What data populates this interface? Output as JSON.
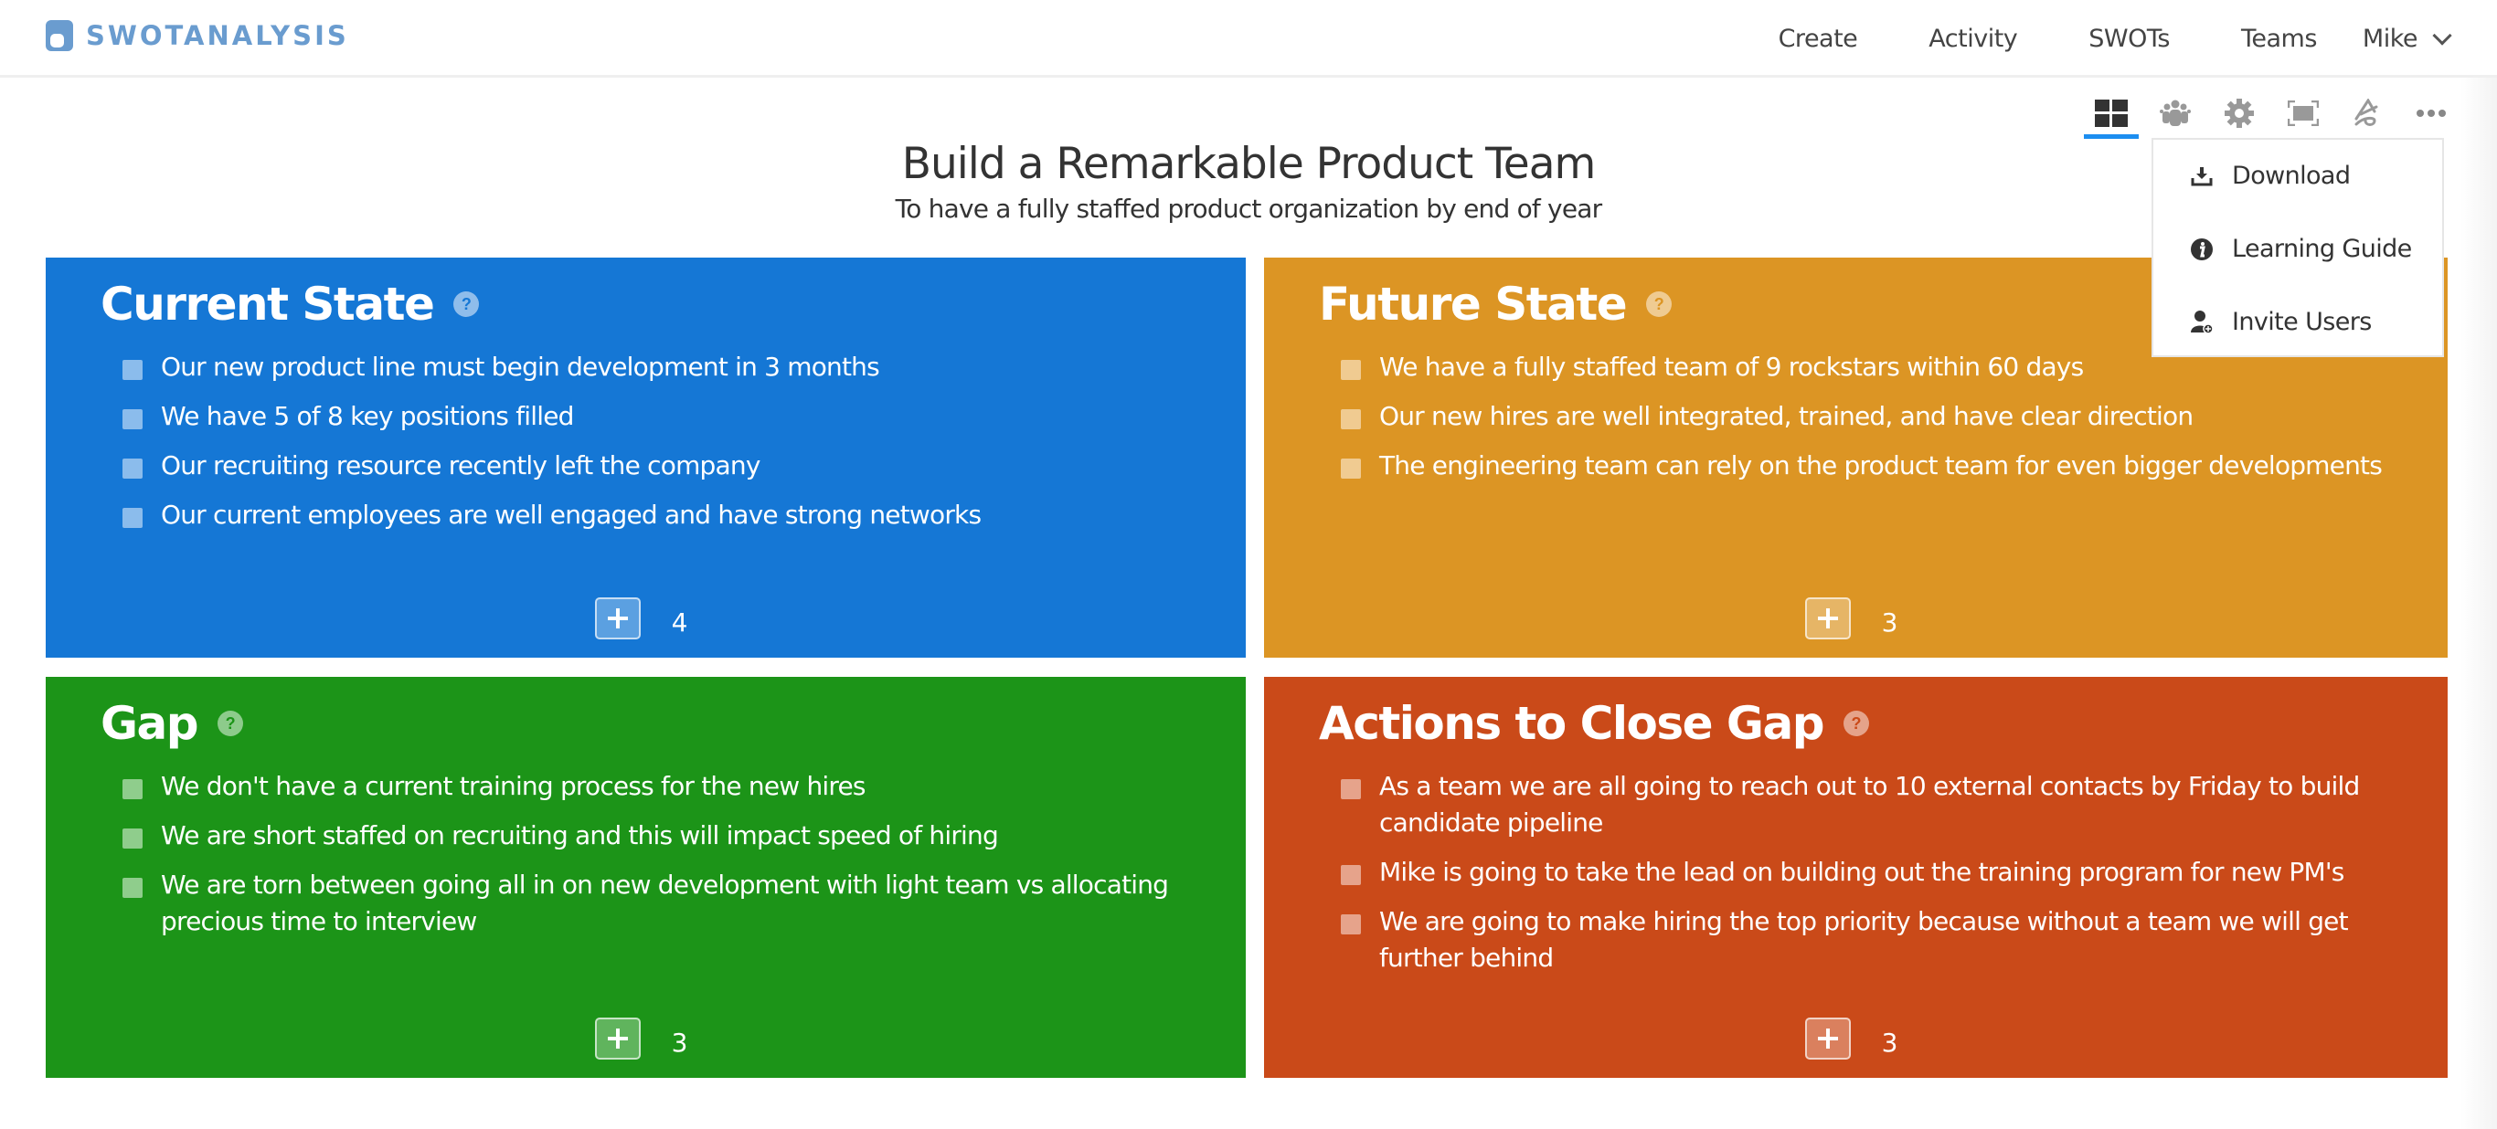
{
  "header": {
    "logo_text": "SWOTANALYSIS",
    "nav": [
      "Create",
      "Activity",
      "SWOTs",
      "Teams"
    ],
    "user": "Mike"
  },
  "toolbar": {
    "icons": [
      "grid-view-icon",
      "team-icon",
      "gear-icon",
      "fullscreen-icon",
      "draw-icon",
      "more-icon"
    ],
    "active": "grid-view-icon",
    "accent": "#1c8ef0"
  },
  "dropdown": {
    "items": [
      {
        "icon": "download-icon",
        "label": "Download"
      },
      {
        "icon": "info-icon",
        "label": "Learning Guide"
      },
      {
        "icon": "invite-user-icon",
        "label": "Invite Users"
      }
    ]
  },
  "page": {
    "title": "Build a Remarkable Product Team",
    "subtitle": "To have a fully staffed product organization by end of year"
  },
  "panels": {
    "current": {
      "title": "Current State",
      "color": "#1577d5",
      "count": "4",
      "items": [
        "Our new product line must begin development in 3 months",
        "We have 5 of 8 key positions filled",
        "Our recruiting resource recently left the company",
        "Our current employees are well engaged and have strong networks"
      ]
    },
    "future": {
      "title": "Future State",
      "color": "#dc9524",
      "count": "3",
      "items": [
        "We have a fully staffed team of 9 rockstars within 60 days",
        "Our new hires are well integrated, trained, and have clear direction",
        "The engineering team can rely on the product team for even bigger developments"
      ]
    },
    "gap": {
      "title": "Gap",
      "color": "#1c9418",
      "count": "3",
      "items": [
        "We don't have a current training process for the new hires",
        "We are short staffed on recruiting and this will impact speed of hiring",
        "We are torn between going all in on new development with light team vs allocating precious time to interview"
      ]
    },
    "actions": {
      "title": "Actions to Close Gap",
      "color": "#ca4a19",
      "count": "3",
      "items": [
        "As a team we are all going to reach out to 10 external contacts by Friday to build candidate pipeline",
        "Mike is going to take the lead on building out the training program for new PM's",
        "We are going to make hiring the top priority because without a team we will get further behind"
      ]
    }
  },
  "help_glyph": "?"
}
